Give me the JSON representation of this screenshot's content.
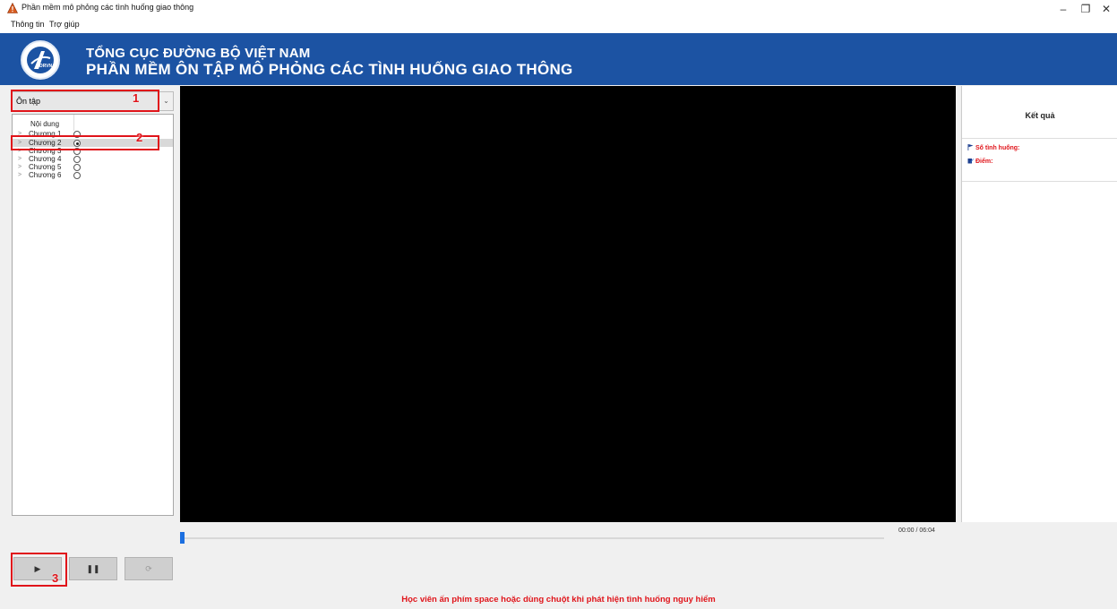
{
  "window": {
    "title": "Phần mềm mô phỏng các tình huống giao thông",
    "controls": [
      "–",
      "❐",
      "✕"
    ]
  },
  "menu": [
    "Thông tin",
    "Trợ giúp"
  ],
  "header": {
    "logo_text": "DRVN",
    "line1": "TỔNG CỤC ĐƯỜNG BỘ VIỆT NAM",
    "line2": "PHẦN MỀM ÔN TẬP MÔ PHỎNG CÁC TÌNH HUỐNG GIAO THÔNG",
    "bg_color": "#1c53a3"
  },
  "mode_select": {
    "value": "Ôn tập",
    "arrow": "⌄"
  },
  "tree": {
    "header": "Nội dung",
    "items": [
      {
        "label": "Chương 1",
        "selected": false
      },
      {
        "label": "Chương 2",
        "selected": true
      },
      {
        "label": "Chương 3",
        "selected": false
      },
      {
        "label": "Chương 4",
        "selected": false
      },
      {
        "label": "Chương 5",
        "selected": false
      },
      {
        "label": "Chương 6",
        "selected": false
      }
    ],
    "arrow": ">"
  },
  "result": {
    "title": "Kết quả",
    "situations_label": "Số tình huống:",
    "score_label": "Điểm:"
  },
  "player": {
    "time": "00:00 / 06:04",
    "progress": 0.0,
    "play": "▶",
    "pause": "❚❚",
    "replay": "⟳"
  },
  "annotations": [
    "1",
    "2",
    "3"
  ],
  "hint": "Học viên ấn phím space hoặc dùng chuột khi phát hiện tình huống nguy hiểm",
  "colors": {
    "accent_red": "#e0141a",
    "progress_blue": "#1c6fe0"
  }
}
